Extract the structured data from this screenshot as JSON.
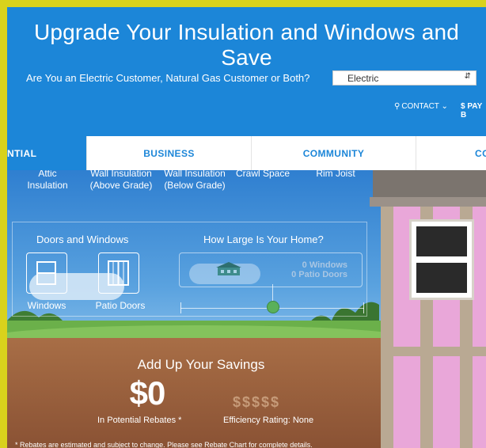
{
  "hero": {
    "title": "Upgrade Your Insulation and Windows and Save",
    "question": "Are You an Electric Customer, Natural Gas Customer or Both?",
    "customer_type_selected": "Electric",
    "contact_label": "CONTACT",
    "pay_label": "$ PAY B"
  },
  "tabs": [
    {
      "label": "NTIAL",
      "active": true
    },
    {
      "label": "BUSINESS",
      "active": false
    },
    {
      "label": "COMMUNITY",
      "active": false
    },
    {
      "label": "CO",
      "active": false
    }
  ],
  "categories": [
    {
      "line1": "Attic",
      "line2": "Insulation"
    },
    {
      "line1": "Wall Insulation",
      "line2": "(Above Grade)"
    },
    {
      "line1": "Wall Insulation",
      "line2": "(Below Grade)"
    },
    {
      "line1": "Crawl Space",
      "line2": ""
    },
    {
      "line1": "Rim Joist",
      "line2": ""
    }
  ],
  "doors_windows": {
    "heading": "Doors and Windows",
    "options": [
      {
        "label": "Windows"
      },
      {
        "label": "Patio Doors"
      }
    ]
  },
  "home_size": {
    "heading": "How Large Is Your Home?",
    "windows_count": "0 Windows",
    "patio_doors_count": "0 Patio Doors"
  },
  "savings": {
    "title": "Add Up Your Savings",
    "amount": "$0",
    "amount_caption": "In Potential Rebates *",
    "efficiency_dollars": "$$$$$",
    "efficiency_caption": "Efficiency Rating: None"
  },
  "footnote": "* Rebates are estimated and subject to change. Please see Rebate Chart for complete details.",
  "colors": {
    "brand_blue": "#1c86d8",
    "frame_yellow": "#d9d21c",
    "insulation_pink": "#e9a7d9"
  }
}
